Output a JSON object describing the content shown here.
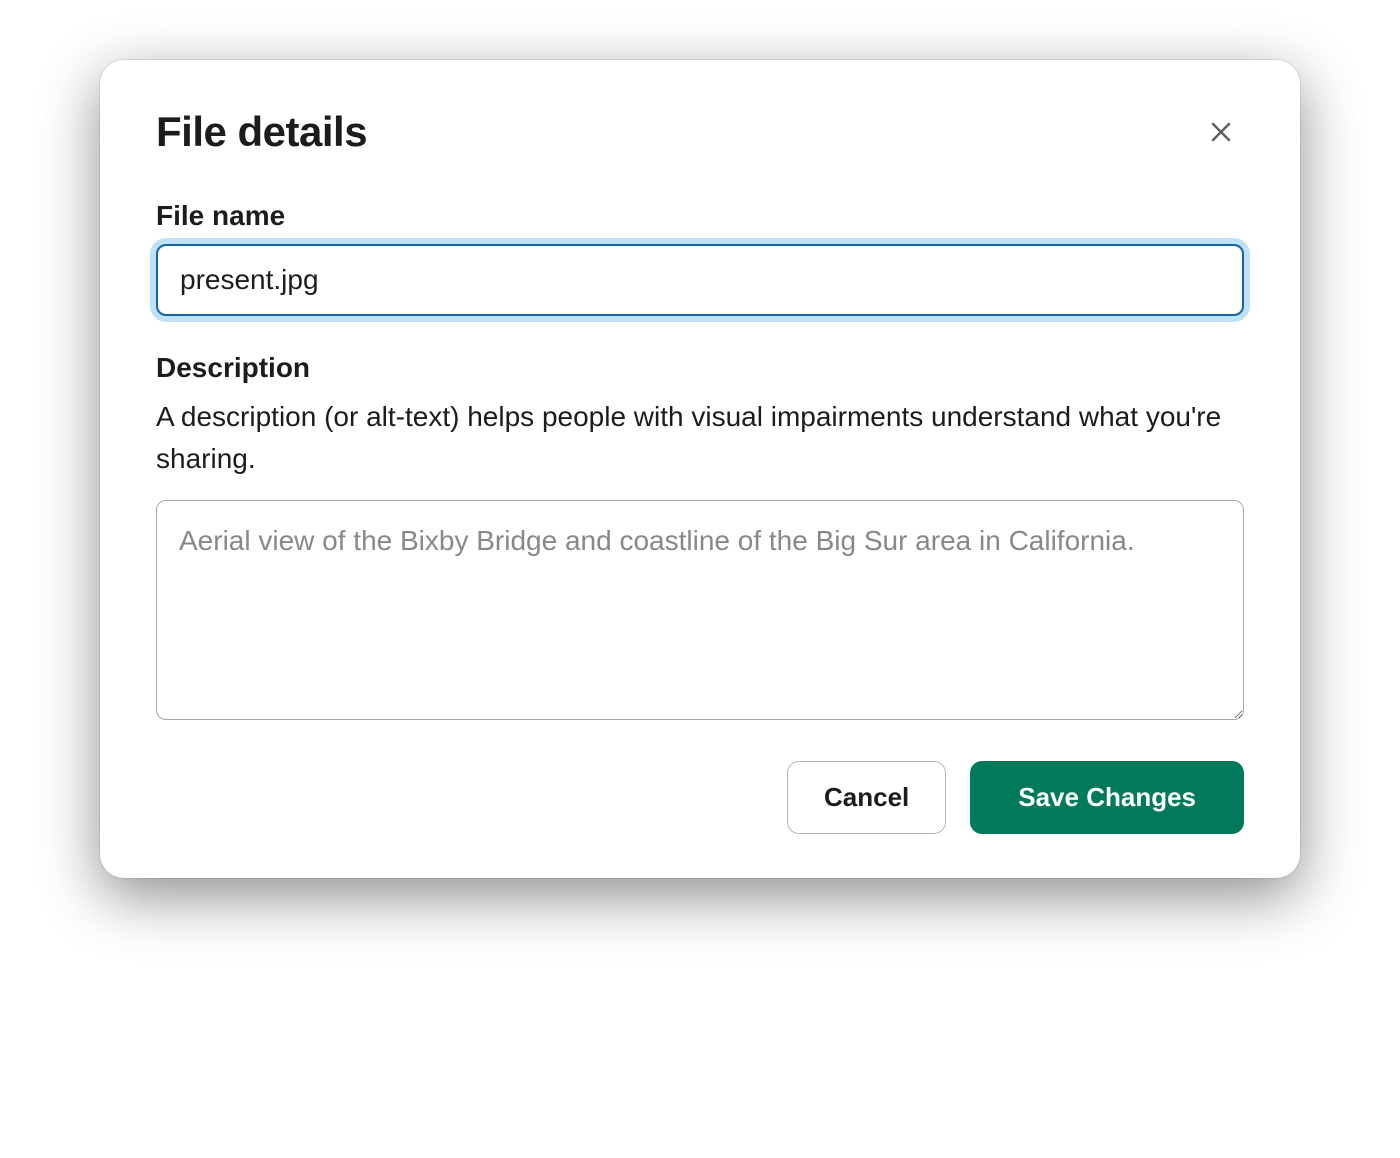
{
  "dialog": {
    "title": "File details",
    "filename": {
      "label": "File name",
      "value": "present.jpg"
    },
    "description": {
      "label": "Description",
      "help": "A description (or alt-text) helps people with visual impairments understand what you're sharing.",
      "placeholder": "Aerial view of the Bixby Bridge and coastline of the Big Sur area in California.",
      "value": ""
    },
    "buttons": {
      "cancel": "Cancel",
      "save": "Save Changes"
    }
  }
}
